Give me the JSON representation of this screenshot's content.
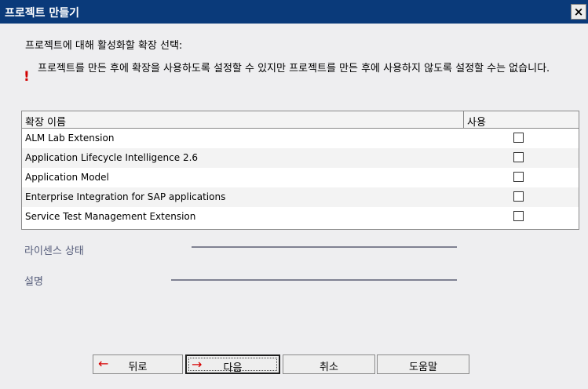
{
  "window": {
    "title": "프로젝트 만들기",
    "close_label": "×"
  },
  "prompt": "프로젝트에 대해 활성화할 확장 선택:",
  "warning": "프로젝트를 만든 후에 확장을 사용하도록 설정할 수 있지만 프로젝트를 만든 후에 사용하지 않도록 설정할 수는 없습니다.",
  "warning_icon": "!",
  "table": {
    "columns": [
      "확장 이름",
      "사용"
    ],
    "rows": [
      {
        "name": "ALM Lab Extension",
        "enabled": false
      },
      {
        "name": "Application Lifecycle Intelligence 2.6",
        "enabled": false
      },
      {
        "name": "Application Model",
        "enabled": false
      },
      {
        "name": "Enterprise Integration for SAP applications",
        "enabled": false
      },
      {
        "name": "Service Test Management Extension",
        "enabled": false
      }
    ]
  },
  "license_status_label": "라이센스 상태",
  "description_label": "설명",
  "buttons": {
    "back": "뒤로",
    "next": "다음",
    "cancel": "취소",
    "help": "도움말",
    "back_arrow": "←",
    "next_arrow": "→"
  },
  "colors": {
    "title_bar": "#0a3a7a",
    "arrow": "#d60000",
    "warning": "#d10000"
  }
}
